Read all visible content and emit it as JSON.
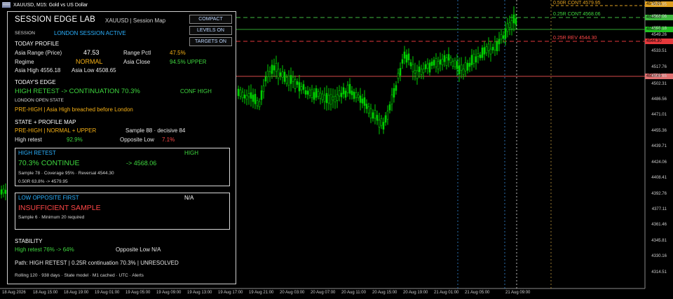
{
  "window": {
    "title": "XAUUSD, M15:  Gold vs US Dollar"
  },
  "panel": {
    "title": "SESSION EDGE LAB",
    "symbol_info": "XAUUSD  |  Session Map",
    "buttons": {
      "compact": "COMPACT",
      "levels": "LEVELS ON",
      "targets": "TARGETS ON"
    },
    "session_label": "SESSION",
    "session_value": "LONDON SESSION ACTIVE",
    "today_profile": "TODAY PROFILE",
    "asia_range_label": "Asia Range (Price)",
    "asia_range_value": "47.53",
    "range_pctl_label": "Range Pctl",
    "range_pctl_value": "47.5%",
    "regime_label": "Regime",
    "regime_value": "NORMAL",
    "asia_close_label": "Asia Close",
    "asia_close_value": "94.5%  UPPER",
    "asia_high": "Asia High  4556.18",
    "asia_low": "Asia Low  4508.65",
    "todays_edge": "TODAY'S EDGE",
    "edge_main": "HIGH RETEST -> CONTINUATION 70.3%",
    "edge_conf": "CONF HIGH",
    "london_open_state": "LONDON OPEN STATE",
    "london_open_value": "PRE-HIGH | Asia High breached before London",
    "state_profile_map": "STATE + PROFILE MAP",
    "map_value": "PRE-HIGH | NORMAL + UPPER",
    "map_sample": "Sample 88  ·  decisive 84",
    "high_retest_label": "High retest",
    "high_retest_value": "92.9%",
    "opposite_low_label": "Opposite Low",
    "opposite_low_value": "7.1%",
    "box1": {
      "title": "HIGH RETEST",
      "badge": "HIGH",
      "main": "70.3% CONTINUE",
      "target": "->  4568.06",
      "stats": "Sample 78  ·  Coverage 95%  ·  Reversal 4544.30",
      "levels": "0.50R  63.8% -> 4579.95"
    },
    "box2": {
      "title": "LOW OPPOSITE FIRST",
      "badge": "N/A",
      "main": "INSUFFICIENT SAMPLE",
      "stats": "Sample 6  ·  Minimum 20 required"
    },
    "stability": "STABILITY",
    "stab_high": "High retest  76% -> 64%",
    "stab_low": "Opposite Low  N/A",
    "path": "Path: HIGH RETEST | 0.25R continuation 70.3% | UNRESOLVED",
    "footer": "Rolling 120  ·  938 days  ·  State model  ·  M1 cached  ·  UTC  ·  Alerts"
  },
  "levels": {
    "cont_050": "0.50R CONT  4579.95",
    "cont_025": "0.25R CONT  4568.06",
    "rev_025": "0.25R REV  4544.30"
  },
  "price_axis": [
    "4579.95",
    "4568.06",
    "4555.18",
    "4549.26",
    "4533.51",
    "4517.76",
    "4508.65",
    "4502.31",
    "4486.56",
    "4471.01",
    "4455.36",
    "4439.71",
    "4424.06",
    "4408.41",
    "4392.76",
    "4377.11",
    "4361.46",
    "4345.81",
    "4330.16",
    "4314.51"
  ],
  "price_tags": {
    "t1": "4579.95",
    "t2": "4568.06",
    "t3": "4555.18",
    "t4": "4544.30",
    "t5": "4508.65"
  },
  "time_axis": [
    "18 Aug 2026",
    "18 Aug 15:00",
    "18 Aug 19:00",
    "19 Aug 01:00",
    "19 Aug 05:00",
    "19 Aug 09:00",
    "19 Aug 13:00",
    "19 Aug 17:00",
    "19 Aug 21:00",
    "20 Aug 03:00",
    "20 Aug 07:00",
    "20 Aug 11:00",
    "20 Aug 15:00",
    "20 Aug 19:00",
    "21 Aug 01:00",
    "21 Aug 05:00",
    "21 Aug 09:00"
  ],
  "colors": {
    "up": "#00d000",
    "cont": "#3fb83f",
    "rev": "#e5383b",
    "target": "#e0a020",
    "asia_low": "#d94a4a"
  }
}
